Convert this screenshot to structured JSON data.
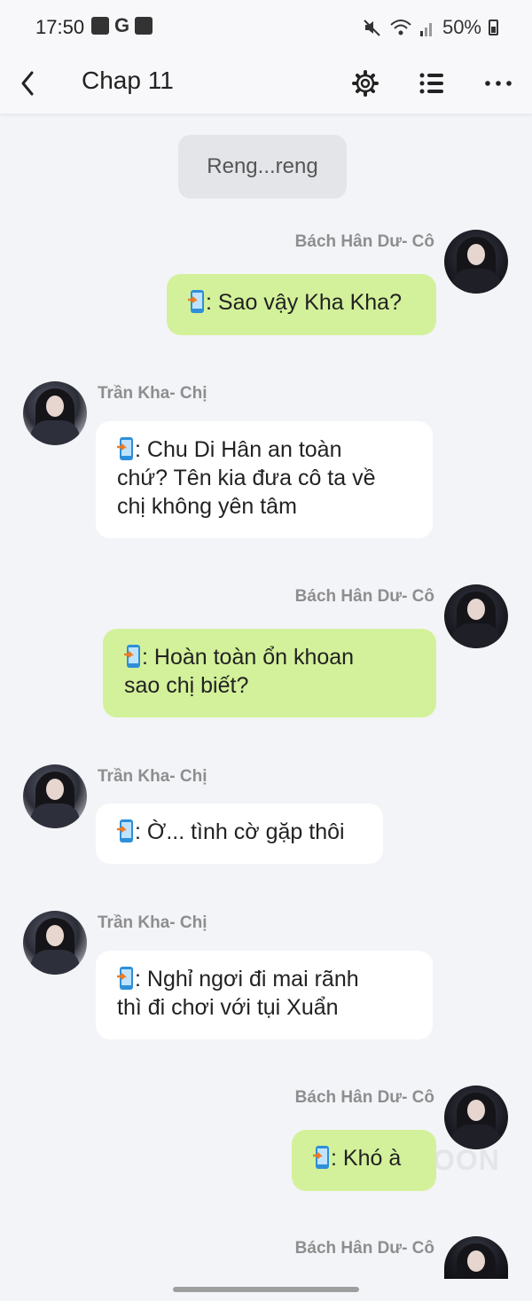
{
  "status_bar": {
    "time": "17:50",
    "g_label": "G",
    "battery": "50%"
  },
  "app_bar": {
    "title": "Chap 11",
    "icons": [
      "back-arrow-icon",
      "gear-icon",
      "list-icon",
      "more-icon"
    ]
  },
  "system_message": "Reng...reng",
  "messages": [
    {
      "sender": "Bách Hân Dư- Cô",
      "side": "right",
      "text": ": Sao vậy Kha Kha?"
    },
    {
      "sender": "Trần Kha- Chị",
      "side": "left",
      "lines": [
        ": Chu Di Hân an toàn",
        "chứ? Tên kia đưa cô ta về",
        "chị không yên tâm"
      ]
    },
    {
      "sender": "Bách Hân Dư- Cô",
      "side": "right",
      "lines": [
        ": Hoàn toàn ổn khoan",
        "sao chị biết?"
      ]
    },
    {
      "sender": "Trần Kha- Chị",
      "side": "left",
      "text": ": Ờ... tình cờ gặp thôi"
    },
    {
      "sender": "Trần Kha- Chị",
      "side": "left",
      "lines": [
        ": Nghỉ ngơi đi mai rãnh",
        "thì đi chơi với tụi Xuẩn"
      ]
    },
    {
      "sender": "Bách Hân Dư- Cô",
      "side": "right",
      "text": ": Khó à"
    },
    {
      "sender": "Bách Hân Dư- Cô",
      "side": "right",
      "text": ""
    }
  ],
  "watermark": "OON",
  "colors": {
    "outgoing_bubble": "#d3f19a",
    "incoming_bubble": "#ffffff",
    "background": "#f3f4f8"
  }
}
